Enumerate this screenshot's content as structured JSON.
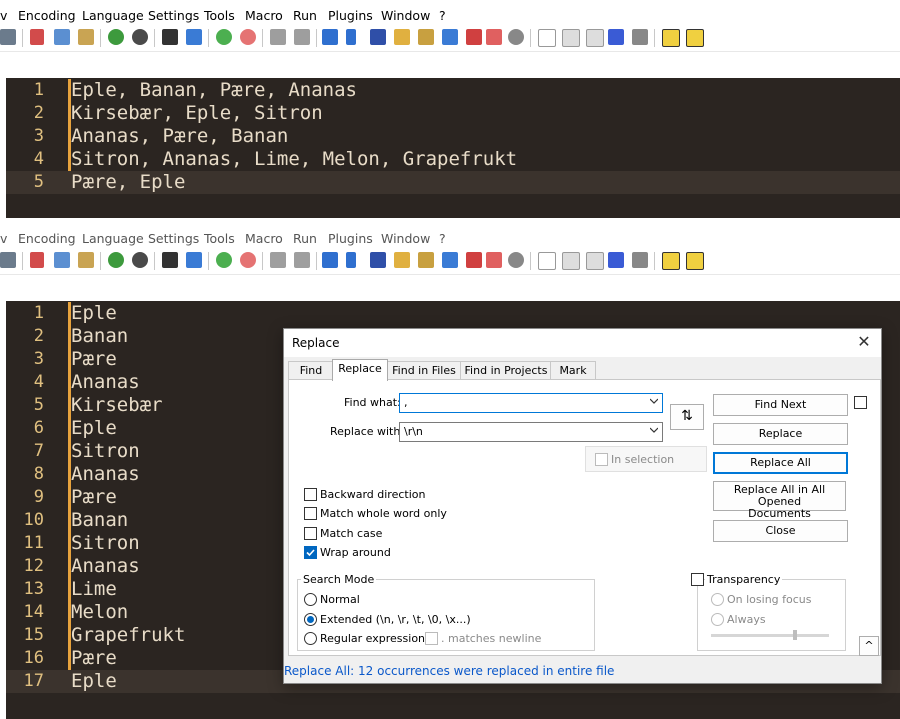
{
  "menu": {
    "items": [
      "v",
      "Encoding",
      "Language",
      "Settings",
      "Tools",
      "Macro",
      "Run",
      "Plugins",
      "Window",
      "?"
    ]
  },
  "editor_top": {
    "lines": [
      {
        "n": "1",
        "text": "Eple, Banan, Pære, Ananas"
      },
      {
        "n": "2",
        "text": "Kirsebær, Eple, Sitron"
      },
      {
        "n": "3",
        "text": "Ananas, Pære, Banan"
      },
      {
        "n": "4",
        "text": "Sitron, Ananas, Lime, Melon, Grapefrukt"
      },
      {
        "n": "5",
        "text": "Pære, Eple"
      }
    ]
  },
  "editor_bottom": {
    "lines": [
      {
        "n": "1",
        "text": "Eple"
      },
      {
        "n": "2",
        "text": "Banan"
      },
      {
        "n": "3",
        "text": "Pære"
      },
      {
        "n": "4",
        "text": "Ananas"
      },
      {
        "n": "5",
        "text": "Kirsebær"
      },
      {
        "n": "6",
        "text": "Eple"
      },
      {
        "n": "7",
        "text": "Sitron"
      },
      {
        "n": "8",
        "text": "Ananas"
      },
      {
        "n": "9",
        "text": "Pære"
      },
      {
        "n": "10",
        "text": "Banan"
      },
      {
        "n": "11",
        "text": "Sitron"
      },
      {
        "n": "12",
        "text": "Ananas"
      },
      {
        "n": "13",
        "text": "Lime"
      },
      {
        "n": "14",
        "text": "Melon"
      },
      {
        "n": "15",
        "text": "Grapefrukt"
      },
      {
        "n": "16",
        "text": "Pære"
      },
      {
        "n": "17",
        "text": "Eple"
      }
    ]
  },
  "dialog": {
    "title": "Replace",
    "close_glyph": "✕",
    "tabs": [
      "Find",
      "Replace",
      "Find in Files",
      "Find in Projects",
      "Mark"
    ],
    "find_what_label": "Find what:",
    "find_what_value": ",",
    "replace_with_label": "Replace with:",
    "replace_with_value": "\\r\\n",
    "swap_glyph": "⇅",
    "in_selection_label": "In selection",
    "buttons": {
      "find_next": "Find Next",
      "replace": "Replace",
      "replace_all": "Replace All",
      "replace_all_opened_line1": "Replace All in All Opened",
      "replace_all_opened_line2": "Documents",
      "close": "Close",
      "expand": "^"
    },
    "options": {
      "backward": "Backward direction",
      "whole_word": "Match whole word only",
      "match_case": "Match case",
      "wrap_around": "Wrap around"
    },
    "search_mode": {
      "title": "Search Mode",
      "normal": "Normal",
      "extended": "Extended (\\n, \\r, \\t, \\0, \\x...)",
      "regex": "Regular expression",
      "matches_newline": ". matches newline"
    },
    "transparency": {
      "title": "Transparency",
      "on_losing_focus": "On losing focus",
      "always": "Always"
    },
    "status": "Replace All: 12 occurrences were replaced in entire file"
  },
  "colors": {
    "editor_bg": "#2b2521",
    "line_numbers": "#e0c080",
    "caret_bar": "#e8a33d",
    "status_text": "#0a58ca",
    "accent": "#0078d7"
  }
}
